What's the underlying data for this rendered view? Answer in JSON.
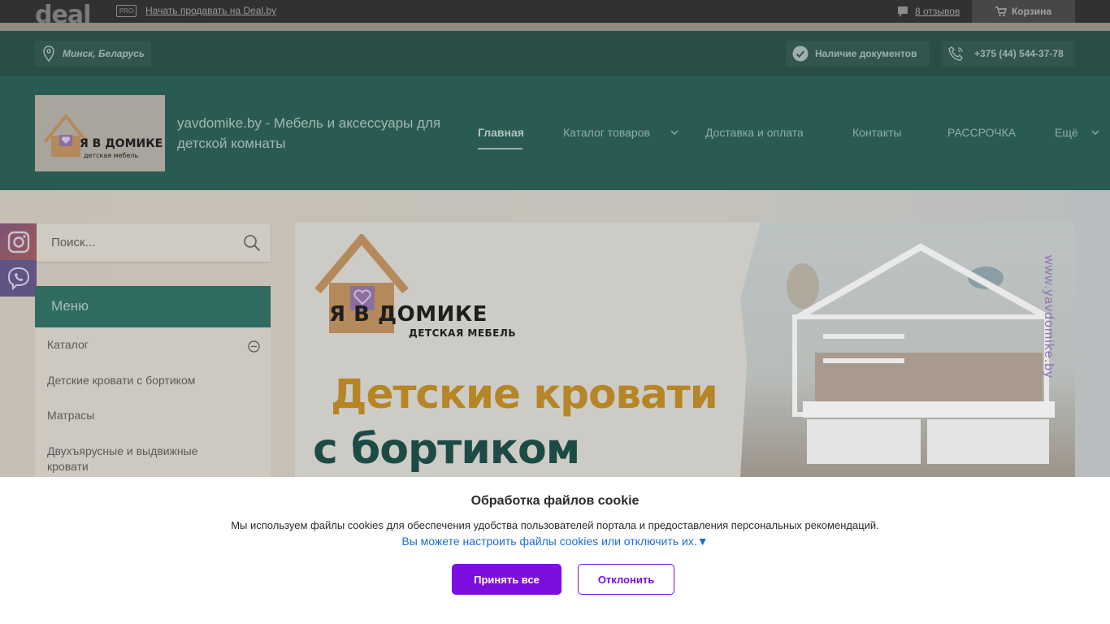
{
  "deal_bar": {
    "logo_text": "deal",
    "pro_badge": "PRO",
    "sell_link": "Начать продавать на Deal.by",
    "reviews_link": "8 отзывов",
    "cart_label": "Корзина"
  },
  "location_bar": {
    "location": "Минск, Беларусь",
    "documents": "Наличие документов",
    "phone": "+375 (44) 544-37-78"
  },
  "header": {
    "site_title": "yavdomike.by - Мебель и аксессуары для детской комнаты",
    "logo_brand": "Я В ДОМИКЕ",
    "logo_sub": "детская мебель",
    "nav": [
      {
        "label": "Главная",
        "active": true
      },
      {
        "label": "Каталог товаров"
      },
      {
        "label": "Доставка и оплата"
      },
      {
        "label": "Контакты"
      },
      {
        "label": "РАССРОЧКА"
      },
      {
        "label": "Ещё"
      }
    ]
  },
  "sidebar": {
    "search_placeholder": "Поиск...",
    "menu_title": "Меню",
    "menu_items": [
      "Каталог",
      "Детские кровати с бортиком",
      "Матрасы",
      "Двухъярусные и выдвижные кровати"
    ]
  },
  "banner": {
    "brand": "Я В ДОМИКЕ",
    "brand_sub": "ДЕТСКАЯ МЕБЕЛЬ",
    "line1": "Детские кровати",
    "line2": "с бортиком",
    "watermark": "www.yavdomike.by"
  },
  "cookie": {
    "title": "Обработка файлов cookie",
    "text": "Мы используем файлы cookies для обеспечения удобства пользователей портала и предоставления персональных рекомендаций.",
    "link": "Вы можете настроить файлы cookies или отключить их.▼",
    "accept": "Принять все",
    "decline": "Отклонить"
  },
  "colors": {
    "header_bg": "#2a5b53",
    "accent_purple": "#7c0ee0",
    "link_blue": "#1b6ed0"
  }
}
